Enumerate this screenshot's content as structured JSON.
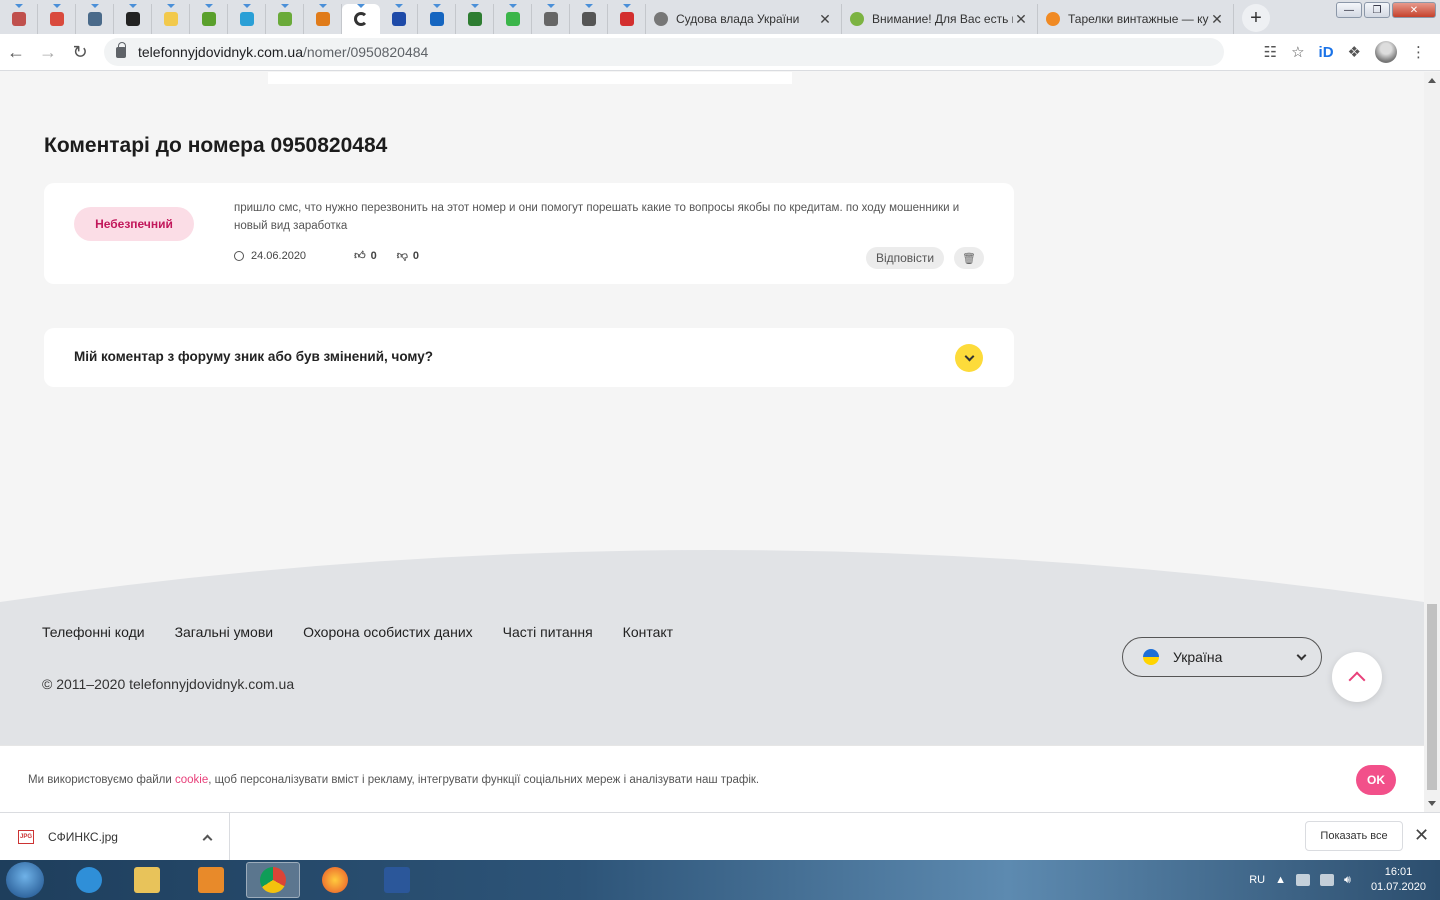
{
  "browser": {
    "pinned_tabs": [
      {
        "icon": "gavel-icon",
        "color": "#c0504d"
      },
      {
        "icon": "car-icon",
        "color": "#d94a3d"
      },
      {
        "icon": "monitor-icon",
        "color": "#4a6a8a"
      },
      {
        "icon": "opera-icon",
        "color": "#222222"
      },
      {
        "icon": "ukraine-flag-icon",
        "color": "#f2c94c"
      },
      {
        "icon": "refresh-green-icon",
        "color": "#5aa02c"
      },
      {
        "icon": "map-pin-icon",
        "color": "#2a9fd6"
      },
      {
        "icon": "leaf-icon",
        "color": "#6aaa3a"
      },
      {
        "icon": "shield-orange-icon",
        "color": "#e07b1a"
      },
      {
        "icon": "loading-ring-icon",
        "color": "#333333",
        "active": true
      },
      {
        "icon": "trident-icon",
        "color": "#1e4aa8"
      },
      {
        "icon": "info-icon",
        "color": "#1565c0"
      },
      {
        "icon": "privat-icon",
        "color": "#2e7d32"
      },
      {
        "icon": "q-green-icon",
        "color": "#3bb54a"
      },
      {
        "icon": "globe-gray-icon",
        "color": "#666666"
      },
      {
        "icon": "rocket-icon",
        "color": "#555555"
      },
      {
        "icon": "rst-icon",
        "color": "#d32f2f"
      }
    ],
    "tabs": [
      {
        "title": "Судова влада України",
        "icon": "globe-icon",
        "color": "#777777"
      },
      {
        "title": "Внимание! Для Вас есть во",
        "icon": "box-icon",
        "color": "#7cb342"
      },
      {
        "title": "Тарелки винтажные — куп",
        "icon": "sun-icon",
        "color": "#f08a24"
      }
    ],
    "new_tab_label": "+",
    "url_host": "telefonnyjdovidnyk.com.ua",
    "url_path": "/nomer/0950820484"
  },
  "comments": {
    "title": "Коментарі до номера 0950820484",
    "items": [
      {
        "badge": "Небезпечний",
        "text": "пришло смс, что нужно перезвонить на этот номер и они помогут порешать какие то вопросы якобы по кредитам. по ходу мошенники и новый вид заработка",
        "date": "24.06.2020",
        "likes": "0",
        "dislikes": "0",
        "reply_label": "Відповісти"
      }
    ]
  },
  "faq": {
    "question": "Мій коментар з форуму зник або був змінений, чому?"
  },
  "footer": {
    "links": [
      "Телефонні коди",
      "Загальні умови",
      "Охорона особистих даних",
      "Часті питання",
      "Контакт"
    ],
    "copyright": "© 2011–2020  telefonnyjdovidnyk.com.ua",
    "country": "Україна"
  },
  "cookie": {
    "text_before": "Ми використовуємо файли ",
    "link": "cookie",
    "text_after": ", щоб персоналізувати вміст і рекламу, інтегрувати функції соціальних мереж і аналізувати наш трафік.",
    "ok_label": "OK"
  },
  "downloads": {
    "file_name": "СФИНКС.jpg",
    "file_type": "JPG",
    "show_all": "Показать все"
  },
  "taskbar": {
    "lang": "RU",
    "time": "16:01",
    "date": "01.07.2020"
  },
  "colors": {
    "accent_pink": "#f2508a",
    "badge_bg": "#fbdde6",
    "faq_toggle": "#fddb3a",
    "footer_bg": "#e1e3e6"
  }
}
